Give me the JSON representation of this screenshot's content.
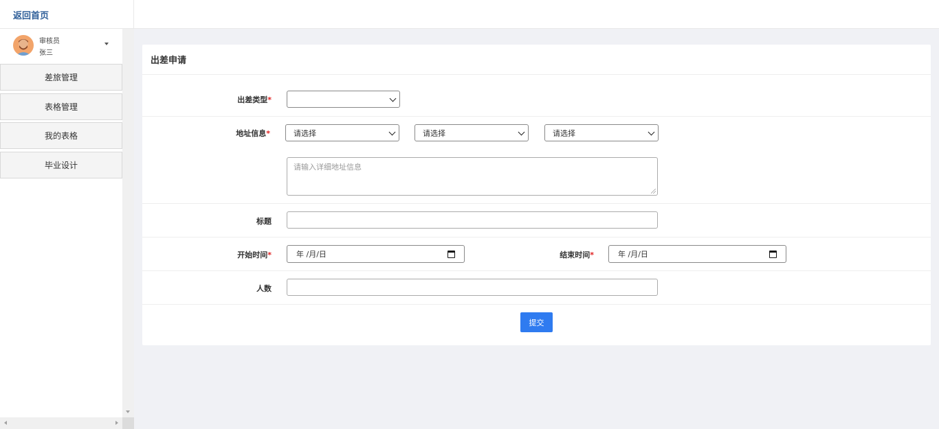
{
  "header": {
    "home_link": "返回首页"
  },
  "user": {
    "role": "审核员",
    "name": "张三"
  },
  "menu": [
    {
      "label": "差旅管理"
    },
    {
      "label": "表格管理"
    },
    {
      "label": "我的表格"
    },
    {
      "label": "毕业设计"
    }
  ],
  "form": {
    "title": "出差申请",
    "type": {
      "label": "出差类型",
      "required": "*",
      "value": ""
    },
    "address": {
      "label": "地址信息",
      "required": "*",
      "province": "请选择",
      "city": "请选择",
      "district": "请选择",
      "detail_placeholder": "请输入详细地址信息"
    },
    "subject": {
      "label": "标题",
      "value": ""
    },
    "start": {
      "label": "开始时间",
      "required": "*",
      "placeholder": "年 /月/日"
    },
    "end": {
      "label": "结束时间",
      "required": "*",
      "placeholder": "年 /月/日"
    },
    "people": {
      "label": "人数",
      "value": ""
    },
    "submit_label": "提交"
  },
  "colors": {
    "accent": "#2f7bf0",
    "link": "#2f5f99",
    "required": "#e02020",
    "background": "#f0f1f5"
  },
  "icons": [
    "chevron-down-icon",
    "calendar-icon",
    "caret-down-icon",
    "avatar"
  ]
}
